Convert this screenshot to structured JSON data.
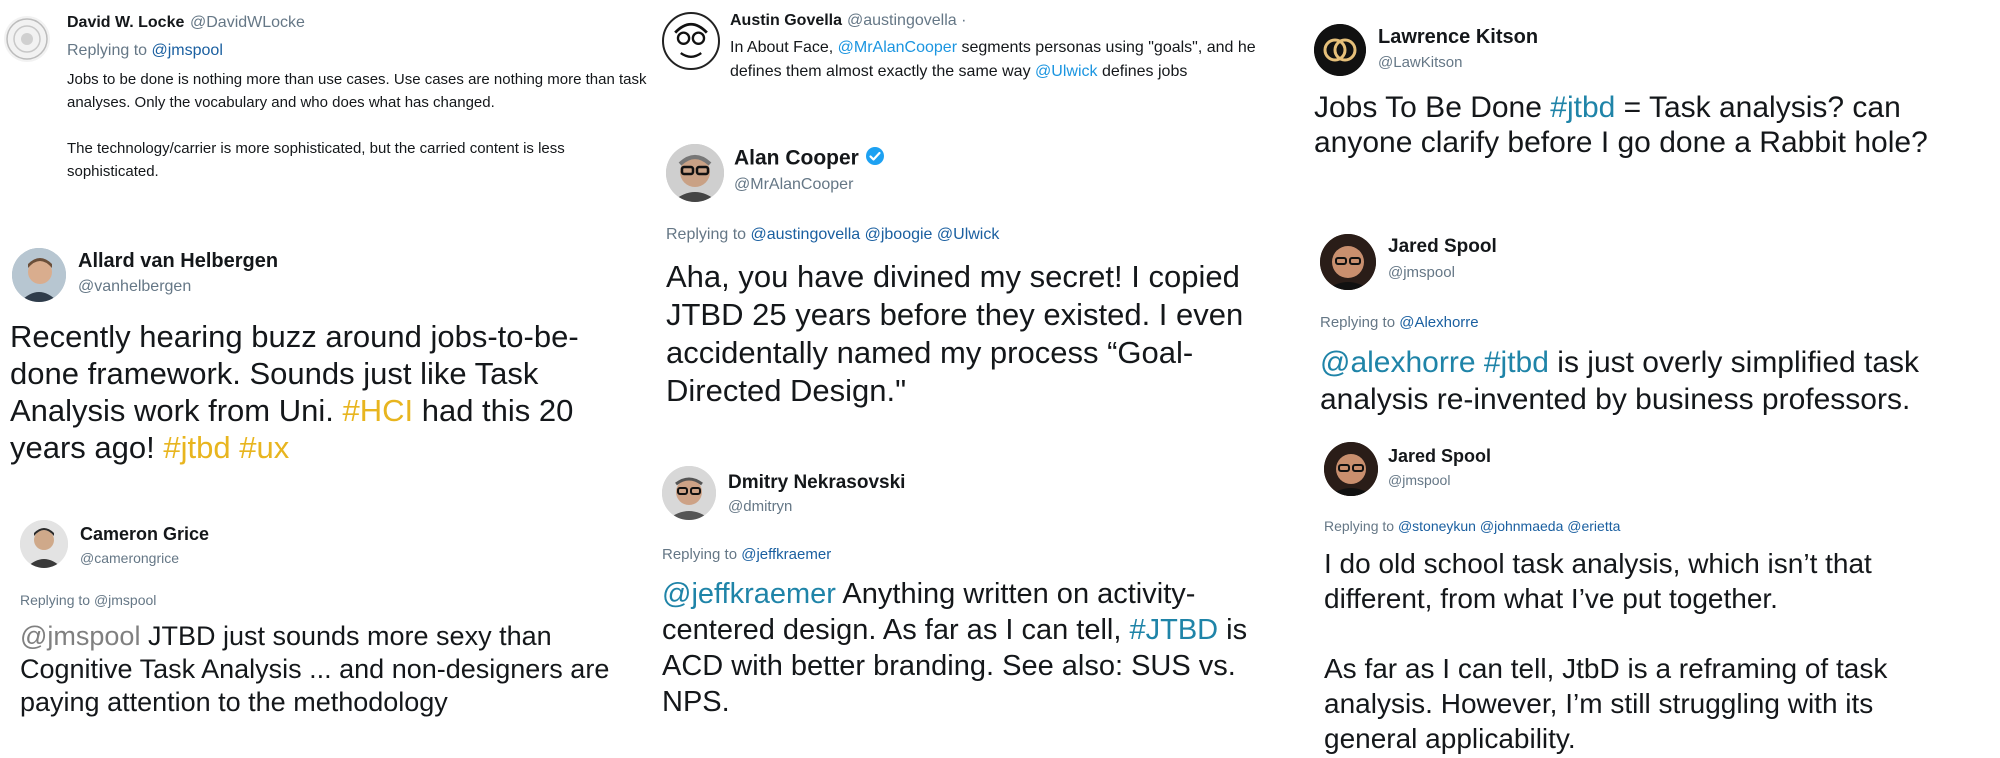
{
  "tweets": {
    "locke": {
      "name": "David W. Locke",
      "handle": "@DavidWLocke",
      "replying_prefix": "Replying to ",
      "replying_to": "@jmspool",
      "para1": "Jobs to be done is nothing more than use cases. Use cases are nothing more than task analyses. Only the vocabulary and who does what has changed.",
      "para2": "The technology/carrier is more sophisticated, but the carried content is less sophisticated."
    },
    "allard": {
      "name": "Allard van Helbergen",
      "handle": "@vanhelbergen",
      "text_a": "Recently hearing buzz around jobs-to-be-done framework. Sounds just like Task Analysis work from Uni. ",
      "tag_hci": "#HCI",
      "text_b": " had this 20 years ago! ",
      "tag_jtbd": "#jtbd",
      "tag_ux": "#ux"
    },
    "cameron": {
      "name": "Cameron Grice",
      "handle": "@camerongrice",
      "replying_prefix": "Replying to ",
      "replying_to": "@jmspool",
      "mention": "@jmspool",
      "text": " JTBD just sounds more sexy than Cognitive Task Analysis ... and non-designers are paying attention to the methodology"
    },
    "austin": {
      "name": "Austin Govella",
      "handle": "@austingovella",
      "dot": "·",
      "text_a": "In About Face, ",
      "mention_cooper": "@MrAlanCooper",
      "text_b": " segments personas using \"goals\", and he defines them almost exactly the same way ",
      "mention_ulwick": "@Ulwick",
      "text_c": " defines jobs"
    },
    "cooper": {
      "name": "Alan Cooper",
      "handle": "@MrAlanCooper",
      "replying_prefix": "Replying to ",
      "reply_1": "@austingovella",
      "reply_2": "@jboogie",
      "reply_3": "@Ulwick",
      "text": "Aha, you have divined my secret! I copied JTBD 25 years before they existed. I even accidentally named my process “Goal-Directed Design.\""
    },
    "dmitry": {
      "name": "Dmitry Nekrasovski",
      "handle": "@dmitryn",
      "replying_prefix": "Replying to ",
      "replying_to": "@jeffkraemer",
      "mention": "@jeffkraemer",
      "text_a": " Anything written on activity-centered design. As far as I can tell, ",
      "tag": "#JTBD",
      "text_b": " is ACD with better branding. See also: SUS vs. NPS."
    },
    "kitson": {
      "name": "Lawrence Kitson",
      "handle": "@LawKitson",
      "text_a": "Jobs To Be Done ",
      "tag": "#jtbd",
      "text_b": " = Task analysis? can anyone clarify before I go done a Rabbit hole?"
    },
    "spool1": {
      "name": "Jared Spool",
      "handle": "@jmspool",
      "replying_prefix": "Replying to ",
      "replying_to": "@Alexhorre",
      "mention": "@alexhorre",
      "tag": "#jtbd",
      "text": " is just overly simplified task analysis re-invented by business professors."
    },
    "spool2": {
      "name": "Jared Spool",
      "handle": "@jmspool",
      "replying_prefix": "Replying to ",
      "reply_1": "@stoneykun",
      "reply_2": "@johnmaeda",
      "reply_3": "@erietta",
      "para1": "I do old school task analysis, which isn’t that different, from what I’ve put together.",
      "para2": "As far as I can tell, JtbD is a reframing of task analysis. However, I’m still struggling with its general applicability."
    }
  },
  "icons": {
    "verified": "verified-badge-icon",
    "colors": {
      "link": "#1b95e0",
      "orange_tag": "#e8b51f",
      "blue_tag": "#1f84a8"
    }
  }
}
